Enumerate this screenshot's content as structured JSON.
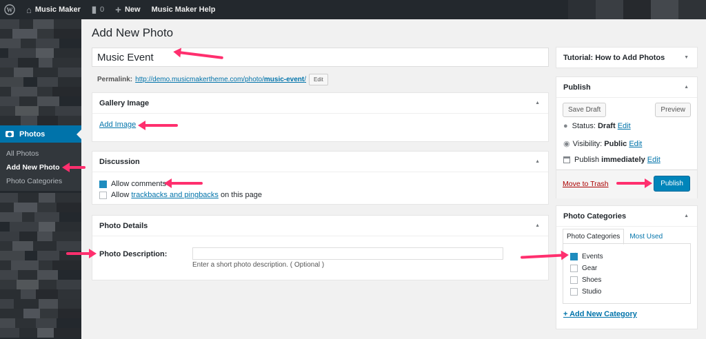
{
  "adminbar": {
    "site_name": "Music Maker",
    "comments_count": "0",
    "new_label": "New",
    "help_label": "Music Maker Help"
  },
  "sidebar": {
    "menu_label": "Photos",
    "submenu": [
      "All Photos",
      "Add New Photo",
      "Photo Categories"
    ]
  },
  "page": {
    "title": "Add New Photo",
    "post_title": "Music Event",
    "permalink_label": "Permalink:",
    "permalink_base": "http://demo.musicmakertheme.com/photo/",
    "permalink_slug": "music-event",
    "permalink_end": "/",
    "edit_label": "Edit"
  },
  "gallery": {
    "heading": "Gallery Image",
    "add_image": "Add Image"
  },
  "discussion": {
    "heading": "Discussion",
    "allow_comments": "Allow comments",
    "allow_prefix": "Allow",
    "trackbacks_link": "trackbacks and pingbacks",
    "allow_suffix": "on this page",
    "allow_comments_checked": true,
    "trackbacks_checked": false
  },
  "details": {
    "heading": "Photo Details",
    "description_label": "Photo Description:",
    "description_value": "",
    "description_hint": "Enter a short photo description. ( Optional )"
  },
  "tutorial": {
    "heading": "Tutorial: How to Add Photos"
  },
  "publish": {
    "heading": "Publish",
    "save_draft": "Save Draft",
    "preview": "Preview",
    "status_label": "Status:",
    "status_value": "Draft",
    "visibility_label": "Visibility:",
    "visibility_value": "Public",
    "publish_label": "Publish",
    "publish_value": "immediately",
    "edit": "Edit",
    "trash": "Move to Trash",
    "publish_button": "Publish"
  },
  "categories": {
    "heading": "Photo Categories",
    "tab_all": "Photo Categories",
    "tab_used": "Most Used",
    "items": [
      {
        "label": "Events",
        "checked": true
      },
      {
        "label": "Gear",
        "checked": false
      },
      {
        "label": "Shoes",
        "checked": false
      },
      {
        "label": "Studio",
        "checked": false
      }
    ],
    "add_new": "+ Add New Category"
  },
  "colors": {
    "accent": "#0073aa",
    "primary_button": "#0085ba",
    "annotation_arrow": "#ff2f6e",
    "trash": "#a00"
  }
}
